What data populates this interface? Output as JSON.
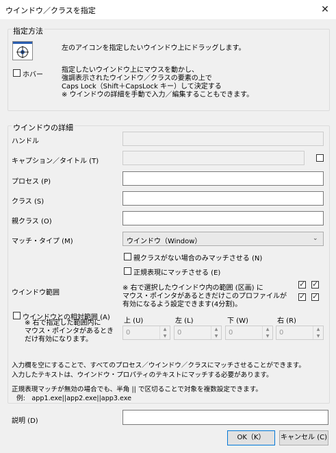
{
  "window": {
    "title": "ウインドウ／クラスを指定",
    "close_glyph": "✕"
  },
  "specify": {
    "group_title": "指定方法",
    "drag_text": "左のアイコンを指定したいウインドウ上にドラッグします。",
    "hover_label": "ホバー",
    "hover_text": "指定したいウインドウ上にマウスを動かし、\n強調表示されたウインドウ／クラスの要素の上で\nCaps Lock（Shift＋CapsLock キー）して決定する\n※ ウインドウの詳細を手動で入力／編集することもできます。"
  },
  "details": {
    "group_title": "ウインドウの詳細",
    "handle_label": "ハンドル",
    "caption_label": "キャプション／タイトル (T)",
    "process_label": "プロセス (P)",
    "class_label": "クラス (S)",
    "parent_class_label": "親クラス (O)",
    "match_type_label": "マッチ・タイプ (M)",
    "match_type_value": "ウインドウ（Window）",
    "no_parent_only_label": "親クラスがない場合のみマッチさせる (N)",
    "regex_label": "正規表現にマッチさせる (E)",
    "window_range_label": "ウインドウ範囲",
    "window_range_note": "※ 右で選択したウインドウ内の範囲 (区画) に\nマウス・ポインタがあるときだけこのプロファイルが\n有効になるよう設定できます(4分割)。",
    "relative_range_label": "ウインドウとの相対範囲 (A)",
    "relative_range_note": "※ 右で指定した範囲内に\nマウス・ポインタがあるとき\nだけ有効になります。",
    "top_label": "上 (U)",
    "left_label": "左 (L)",
    "bottom_label": "下 (W)",
    "right_label": "右 (R)",
    "top_value": "0",
    "left_value": "0",
    "bottom_value": "0",
    "right_value": "0",
    "info_text": "入力欄を空にすることで、すべてのプロセス／ウインドウ／クラスにマッチさせることができます。\n入力したテキストは、ウインドウ・プロパティのテキストにマッチする必要があります。",
    "regex_info": "正規表現マッチが無効の場合でも、半角 || で区切ることで対象を複数設定できます。",
    "example": "例:　app1.exe||app2.exe||app3.exe"
  },
  "description_label": "説明 (D)",
  "buttons": {
    "ok": "OK（K）",
    "cancel": "キャンセル (C)"
  },
  "colors": {
    "background": "#f0f0f0",
    "accent": "#0078d7"
  },
  "icons": {
    "target": "crosshair-target-icon",
    "dropdown": "chevron-down-icon"
  }
}
